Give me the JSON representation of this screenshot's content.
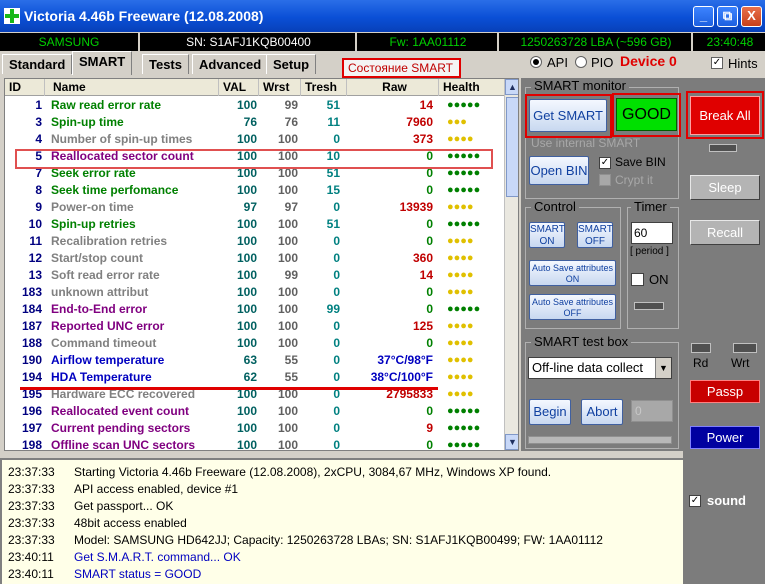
{
  "window": {
    "title": "Victoria 4.46b Freeware (12.08.2008)",
    "minimize_label": "_",
    "restore_label": "⧉",
    "close_label": "X"
  },
  "infobar": {
    "model": "SAMSUNG",
    "serial": "SN: S1AFJ1KQB00400",
    "firmware": "Fw: 1AA01112",
    "capacity": "1250263728 LBA (~596 GB)",
    "time": "23:40:48"
  },
  "tabs": [
    "Standard",
    "SMART",
    "Tests",
    "Advanced",
    "Setup"
  ],
  "annotation_label": "Состояние SMART",
  "mode": {
    "api": "API",
    "pio": "PIO",
    "device": "Device 0",
    "hints": "Hints"
  },
  "table": {
    "headers": [
      "ID",
      "Name",
      "VAL",
      "Wrst",
      "Tresh",
      "Raw",
      "Health"
    ],
    "rows": [
      {
        "id": "1",
        "name": "Raw read error rate",
        "val": "100",
        "wrst": "99",
        "tresh": "51",
        "raw": "14",
        "health": "●●●●●",
        "name_color": "#008000",
        "health_color": "#008000"
      },
      {
        "id": "3",
        "name": "Spin-up time",
        "val": "76",
        "wrst": "76",
        "tresh": "11",
        "raw": "7960",
        "health": "●●●",
        "name_color": "#008000",
        "health_color": "#e0c000"
      },
      {
        "id": "4",
        "name": "Number of spin-up times",
        "val": "100",
        "wrst": "100",
        "tresh": "0",
        "raw": "373",
        "health": "●●●●",
        "name_color": "#808080",
        "health_color": "#e0c000"
      },
      {
        "id": "5",
        "name": "Reallocated sector count",
        "val": "100",
        "wrst": "100",
        "tresh": "10",
        "raw": "0",
        "health": "●●●●●",
        "name_color": "#800080",
        "health_color": "#008000"
      },
      {
        "id": "7",
        "name": "Seek error rate",
        "val": "100",
        "wrst": "100",
        "tresh": "51",
        "raw": "0",
        "health": "●●●●●",
        "name_color": "#008000",
        "health_color": "#008000"
      },
      {
        "id": "8",
        "name": "Seek time perfomance",
        "val": "100",
        "wrst": "100",
        "tresh": "15",
        "raw": "0",
        "health": "●●●●●",
        "name_color": "#008000",
        "health_color": "#008000"
      },
      {
        "id": "9",
        "name": "Power-on time",
        "val": "97",
        "wrst": "97",
        "tresh": "0",
        "raw": "13939",
        "health": "●●●●",
        "name_color": "#808080",
        "health_color": "#e0c000"
      },
      {
        "id": "10",
        "name": "Spin-up retries",
        "val": "100",
        "wrst": "100",
        "tresh": "51",
        "raw": "0",
        "health": "●●●●●",
        "name_color": "#008000",
        "health_color": "#008000"
      },
      {
        "id": "11",
        "name": "Recalibration retries",
        "val": "100",
        "wrst": "100",
        "tresh": "0",
        "raw": "0",
        "health": "●●●●",
        "name_color": "#808080",
        "health_color": "#e0c000"
      },
      {
        "id": "12",
        "name": "Start/stop count",
        "val": "100",
        "wrst": "100",
        "tresh": "0",
        "raw": "360",
        "health": "●●●●",
        "name_color": "#808080",
        "health_color": "#e0c000"
      },
      {
        "id": "13",
        "name": "Soft read error rate",
        "val": "100",
        "wrst": "99",
        "tresh": "0",
        "raw": "14",
        "health": "●●●●",
        "name_color": "#808080",
        "health_color": "#e0c000"
      },
      {
        "id": "183",
        "name": "unknown attribut",
        "val": "100",
        "wrst": "100",
        "tresh": "0",
        "raw": "0",
        "health": "●●●●",
        "name_color": "#808080",
        "health_color": "#e0c000"
      },
      {
        "id": "184",
        "name": "End-to-End error",
        "val": "100",
        "wrst": "100",
        "tresh": "99",
        "raw": "0",
        "health": "●●●●●",
        "name_color": "#800080",
        "health_color": "#008000"
      },
      {
        "id": "187",
        "name": "Reported UNC error",
        "val": "100",
        "wrst": "100",
        "tresh": "0",
        "raw": "125",
        "health": "●●●●",
        "name_color": "#800080",
        "health_color": "#e0c000"
      },
      {
        "id": "188",
        "name": "Command timeout",
        "val": "100",
        "wrst": "100",
        "tresh": "0",
        "raw": "0",
        "health": "●●●●",
        "name_color": "#808080",
        "health_color": "#e0c000"
      },
      {
        "id": "190",
        "name": "Airflow temperature",
        "val": "63",
        "wrst": "55",
        "tresh": "0",
        "raw": "37°C/98°F",
        "health": "●●●●",
        "name_color": "#0000c0",
        "health_color": "#e0c000"
      },
      {
        "id": "194",
        "name": "HDA Temperature",
        "val": "62",
        "wrst": "55",
        "tresh": "0",
        "raw": "38°C/100°F",
        "health": "●●●●",
        "name_color": "#0000c0",
        "health_color": "#e0c000"
      },
      {
        "id": "195",
        "name": "Hardware ECC recovered",
        "val": "100",
        "wrst": "100",
        "tresh": "0",
        "raw": "2795833",
        "health": "●●●●",
        "name_color": "#808080",
        "health_color": "#e0c000"
      },
      {
        "id": "196",
        "name": "Reallocated event count",
        "val": "100",
        "wrst": "100",
        "tresh": "0",
        "raw": "0",
        "health": "●●●●●",
        "name_color": "#800080",
        "health_color": "#008000"
      },
      {
        "id": "197",
        "name": "Current pending sectors",
        "val": "100",
        "wrst": "100",
        "tresh": "0",
        "raw": "9",
        "health": "●●●●●",
        "name_color": "#800080",
        "health_color": "#008000"
      },
      {
        "id": "198",
        "name": "Offline scan UNC sectors",
        "val": "100",
        "wrst": "100",
        "tresh": "0",
        "raw": "0",
        "health": "●●●●●",
        "name_color": "#800080",
        "health_color": "#008000"
      }
    ]
  },
  "smart_monitor": {
    "title": "SMART monitor",
    "get_smart": "Get SMART",
    "status": "GOOD",
    "user_smart": "Use internal SMART",
    "save_bin": "Save BIN",
    "open_bin": "Open BIN",
    "crypt": "Crypt it"
  },
  "control": {
    "title": "Control",
    "smart_on": "SMART ON",
    "smart_off": "SMART OFF",
    "autosave_on": "Auto Save attributes ON",
    "autosave_off": "Auto Save attributes OFF"
  },
  "timer": {
    "title": "Timer",
    "value": "60",
    "period": "[ period ]",
    "on": "ON"
  },
  "test_box": {
    "title": "SMART test box",
    "selected": "Off-line data collect",
    "begin": "Begin",
    "abort": "Abort",
    "field_value": "0"
  },
  "toolbar": {
    "break_all": "Break All",
    "sleep": "Sleep",
    "recall": "Recall",
    "rd": "Rd",
    "wrt": "Wrt",
    "passp": "Passp",
    "power": "Power",
    "sound": "sound"
  },
  "log": [
    {
      "time": "23:37:33",
      "text": "Starting Victoria 4.46b Freeware (12.08.2008), 2xCPU, 3084,67 MHz, Windows XP found.",
      "color": "#000000"
    },
    {
      "time": "23:37:33",
      "text": "API access enabled, device #1",
      "color": "#000000"
    },
    {
      "time": "23:37:33",
      "text": "Get passport... OK",
      "color": "#000000"
    },
    {
      "time": "23:37:33",
      "text": "48bit access enabled",
      "color": "#000000"
    },
    {
      "time": "23:37:33",
      "text": "Model: SAMSUNG HD642JJ; Capacity: 1250263728 LBAs; SN: S1AFJ1KQB00499; FW: 1AA01112",
      "color": "#000000"
    },
    {
      "time": "23:40:11",
      "text": "Get S.M.A.R.T. command... OK",
      "color": "#0000c0"
    },
    {
      "time": "23:40:11",
      "text": "SMART status = GOOD",
      "color": "#0000c0"
    }
  ]
}
